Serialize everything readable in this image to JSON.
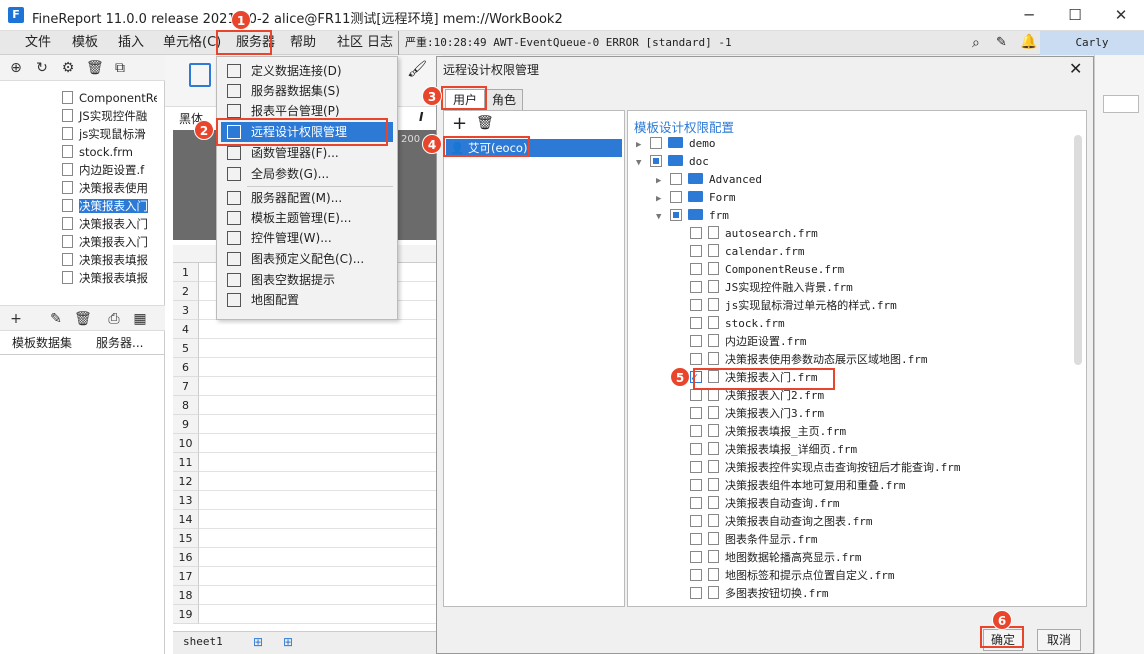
{
  "window": {
    "title": "FineReport 11.0.0 release 2021-10-2 alice@FR11测试[远程环境]    mem://WorkBook2",
    "logo": "F",
    "min": "─",
    "max": "☐",
    "close": "✕"
  },
  "menubar": {
    "items": [
      "文件",
      "模板",
      "插入",
      "单元格(C)",
      "服务器",
      "帮助",
      "社区",
      "日志"
    ],
    "log": "严重:10:28:49 AWT-EventQueue-0 ERROR [standard] -1",
    "user": "Carly"
  },
  "file_list": [
    "ComponentReu",
    "JS实现控件融",
    "js实现鼠标滑",
    "stock.frm",
    "内边距设置.f",
    "决策报表使用",
    "决策报表入门",
    "决策报表入门",
    "决策报表入门",
    "决策报表填报",
    "决策报表填报"
  ],
  "left_tabs": [
    "模板数据集",
    "服务器..."
  ],
  "editor": {
    "font": "黑体",
    "ruler_label": "200",
    "rows": [
      "1",
      "2",
      "3",
      "4",
      "5",
      "6",
      "7",
      "8",
      "9",
      "10",
      "11",
      "12",
      "13",
      "14",
      "15",
      "16",
      "17",
      "18",
      "19"
    ],
    "sheet": "sheet1"
  },
  "server_menu": [
    {
      "label": "定义数据连接(D)",
      "icon": "database-connection-icon"
    },
    {
      "label": "服务器数据集(S)",
      "icon": "server-dataset-icon"
    },
    {
      "label": "报表平台管理(P)",
      "icon": "platform-user-icon"
    },
    {
      "label": "远程设计权限管理",
      "icon": "remote-permission-icon"
    },
    {
      "label": "函数管理器(F)...",
      "icon": "function-manager-icon"
    },
    {
      "label": "全局参数(G)...",
      "icon": "global-param-icon"
    },
    {
      "label": "服务器配置(M)...",
      "icon": "server-config-icon"
    },
    {
      "label": "模板主题管理(E)...",
      "icon": "theme-icon"
    },
    {
      "label": "控件管理(W)...",
      "icon": "widget-icon"
    },
    {
      "label": "图表预定义配色(C)...",
      "icon": "chart-color-icon"
    },
    {
      "label": "图表空数据提示",
      "icon": "chart-empty-icon"
    },
    {
      "label": "地图配置",
      "icon": "map-icon"
    }
  ],
  "dialog": {
    "title": "远程设计权限管理",
    "tabs": [
      "用户",
      "角色"
    ],
    "user": "艾可(eoco)",
    "config_title": "模板设计权限配置",
    "tree": [
      {
        "label": "demo",
        "level": 0,
        "type": "folder",
        "state": "none",
        "arrow": "▶"
      },
      {
        "label": "doc",
        "level": 0,
        "type": "folder",
        "state": "partial",
        "arrow": "▼"
      },
      {
        "label": "Advanced",
        "level": 1,
        "type": "folder",
        "state": "none",
        "arrow": "▶"
      },
      {
        "label": "Form",
        "level": 1,
        "type": "folder",
        "state": "none",
        "arrow": "▶"
      },
      {
        "label": "frm",
        "level": 1,
        "type": "folder",
        "state": "partial",
        "arrow": "▼"
      },
      {
        "label": "autosearch.frm",
        "level": 2,
        "type": "file",
        "state": "none"
      },
      {
        "label": "calendar.frm",
        "level": 2,
        "type": "file",
        "state": "none"
      },
      {
        "label": "ComponentReuse.frm",
        "level": 2,
        "type": "file",
        "state": "none"
      },
      {
        "label": "JS实现控件融入背景.frm",
        "level": 2,
        "type": "file",
        "state": "none"
      },
      {
        "label": "js实现鼠标滑过单元格的样式.frm",
        "level": 2,
        "type": "file",
        "state": "none"
      },
      {
        "label": "stock.frm",
        "level": 2,
        "type": "file",
        "state": "none"
      },
      {
        "label": "内边距设置.frm",
        "level": 2,
        "type": "file",
        "state": "none"
      },
      {
        "label": "决策报表使用参数动态展示区域地图.frm",
        "level": 2,
        "type": "file",
        "state": "none"
      },
      {
        "label": "决策报表入门.frm",
        "level": 2,
        "type": "file",
        "state": "checked"
      },
      {
        "label": "决策报表入门2.frm",
        "level": 2,
        "type": "file",
        "state": "none"
      },
      {
        "label": "决策报表入门3.frm",
        "level": 2,
        "type": "file",
        "state": "none"
      },
      {
        "label": "决策报表填报_主页.frm",
        "level": 2,
        "type": "file",
        "state": "none"
      },
      {
        "label": "决策报表填报_详细页.frm",
        "level": 2,
        "type": "file",
        "state": "none"
      },
      {
        "label": "决策报表控件实现点击查询按钮后才能查询.frm",
        "level": 2,
        "type": "file",
        "state": "none"
      },
      {
        "label": "决策报表组件本地可复用和重叠.frm",
        "level": 2,
        "type": "file",
        "state": "none"
      },
      {
        "label": "决策报表自动查询.frm",
        "level": 2,
        "type": "file",
        "state": "none"
      },
      {
        "label": "决策报表自动查询之图表.frm",
        "level": 2,
        "type": "file",
        "state": "none"
      },
      {
        "label": "图表条件显示.frm",
        "level": 2,
        "type": "file",
        "state": "none"
      },
      {
        "label": "地图数据轮播高亮显示.frm",
        "level": 2,
        "type": "file",
        "state": "none"
      },
      {
        "label": "地图标签和提示点位置自定义.frm",
        "level": 2,
        "type": "file",
        "state": "none"
      },
      {
        "label": "多图表按钮切换.frm",
        "level": 2,
        "type": "file",
        "state": "none"
      }
    ],
    "ok": "确定",
    "cancel": "取消"
  },
  "badges": [
    "1",
    "2",
    "3",
    "4",
    "5",
    "6"
  ],
  "colors": {
    "accent": "#2d7ad6",
    "annotation": "#e8452c"
  }
}
